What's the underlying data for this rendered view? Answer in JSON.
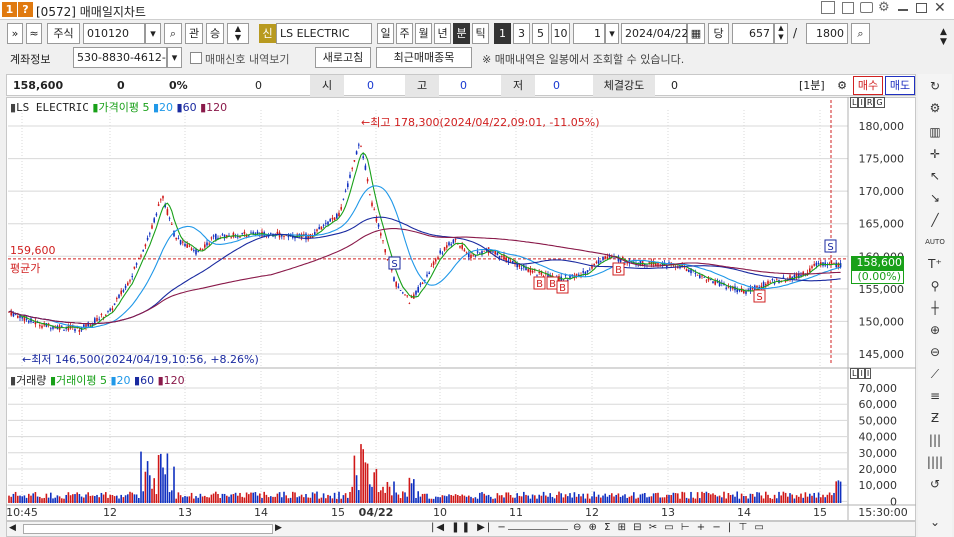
{
  "window": {
    "code": "[0572]",
    "title": "매매일지차트"
  },
  "toolbar": {
    "chevrons": "»",
    "up": "≈",
    "market": "주식",
    "stock_code": "010120",
    "btn_kwan": "관",
    "btn_seung": "승",
    "tag_sin": "신",
    "stock_name": "LS ELECTRIC",
    "periods": [
      "일",
      "주",
      "월",
      "년",
      "분",
      "틱"
    ],
    "minutes": [
      "1",
      "3",
      "5",
      "10"
    ],
    "interval": "1",
    "date": "2024/04/22",
    "dang": "당",
    "count": "657",
    "slash": "/",
    "total": "1800"
  },
  "row2": {
    "account_label": "계좌정보",
    "account": "530-8830-4612-",
    "signal_label": "매매신호 내역보기",
    "refresh": "새로고침",
    "recent_button": "최근매매종목",
    "note": "※ 매매내역은 일봉에서 조회할 수 있습니다."
  },
  "quote": {
    "price": "158,600",
    "change": "0",
    "rate": "0%",
    "volume": "0",
    "open_label": "시",
    "open": "0",
    "high_label": "고",
    "high": "0",
    "low_label": "저",
    "low": "0",
    "strength_label": "체결강도",
    "strength": "0",
    "period_label": "[1분]",
    "buy": "매수",
    "sell": "매도"
  },
  "price_pane": {
    "legend_name": "LS ELECTRIC",
    "legend_ma": "가격이평",
    "ma": [
      "5",
      "20",
      "60",
      "120"
    ],
    "flags": [
      "L",
      "I",
      "R",
      "G"
    ],
    "max_note": "←최고 178,300(2024/04/22,09:01, -11.05%)",
    "min_note": "←최저 146,500(2024/04/19,10:56, +8.26%)",
    "avg_value": "159,600",
    "avg_label": "평균가",
    "cur_price": "158,600",
    "cur_rate": "(0.00%)",
    "y_ticks": [
      "180,000",
      "175,000",
      "170,000",
      "165,000",
      "160,000",
      "155,000",
      "150,000",
      "145,000"
    ],
    "markers": [
      "B",
      "B",
      "B",
      "B",
      "S",
      "S"
    ]
  },
  "vol_pane": {
    "legend": "거래량",
    "legend_ma": "거래이평",
    "ma": [
      "5",
      "20",
      "60",
      "120"
    ],
    "flags": [
      "L",
      "I",
      "I"
    ],
    "y_ticks": [
      "70,000",
      "60,000",
      "50,000",
      "40,000",
      "30,000",
      "20,000",
      "10,000",
      "0"
    ]
  },
  "x_axis": {
    "labels": [
      "10:45",
      "12",
      "13",
      "14",
      "15",
      "04/22",
      "10",
      "11",
      "12",
      "13",
      "14",
      "15"
    ],
    "time": "15:30:00"
  },
  "colors": {
    "ma5": "#18a018",
    "ma20": "#2098e8",
    "ma60": "#1a2aa0",
    "ma120": "#8a1a4a",
    "up": "#d01818",
    "down": "#1030c0",
    "grid": "#d8d8d8"
  }
}
